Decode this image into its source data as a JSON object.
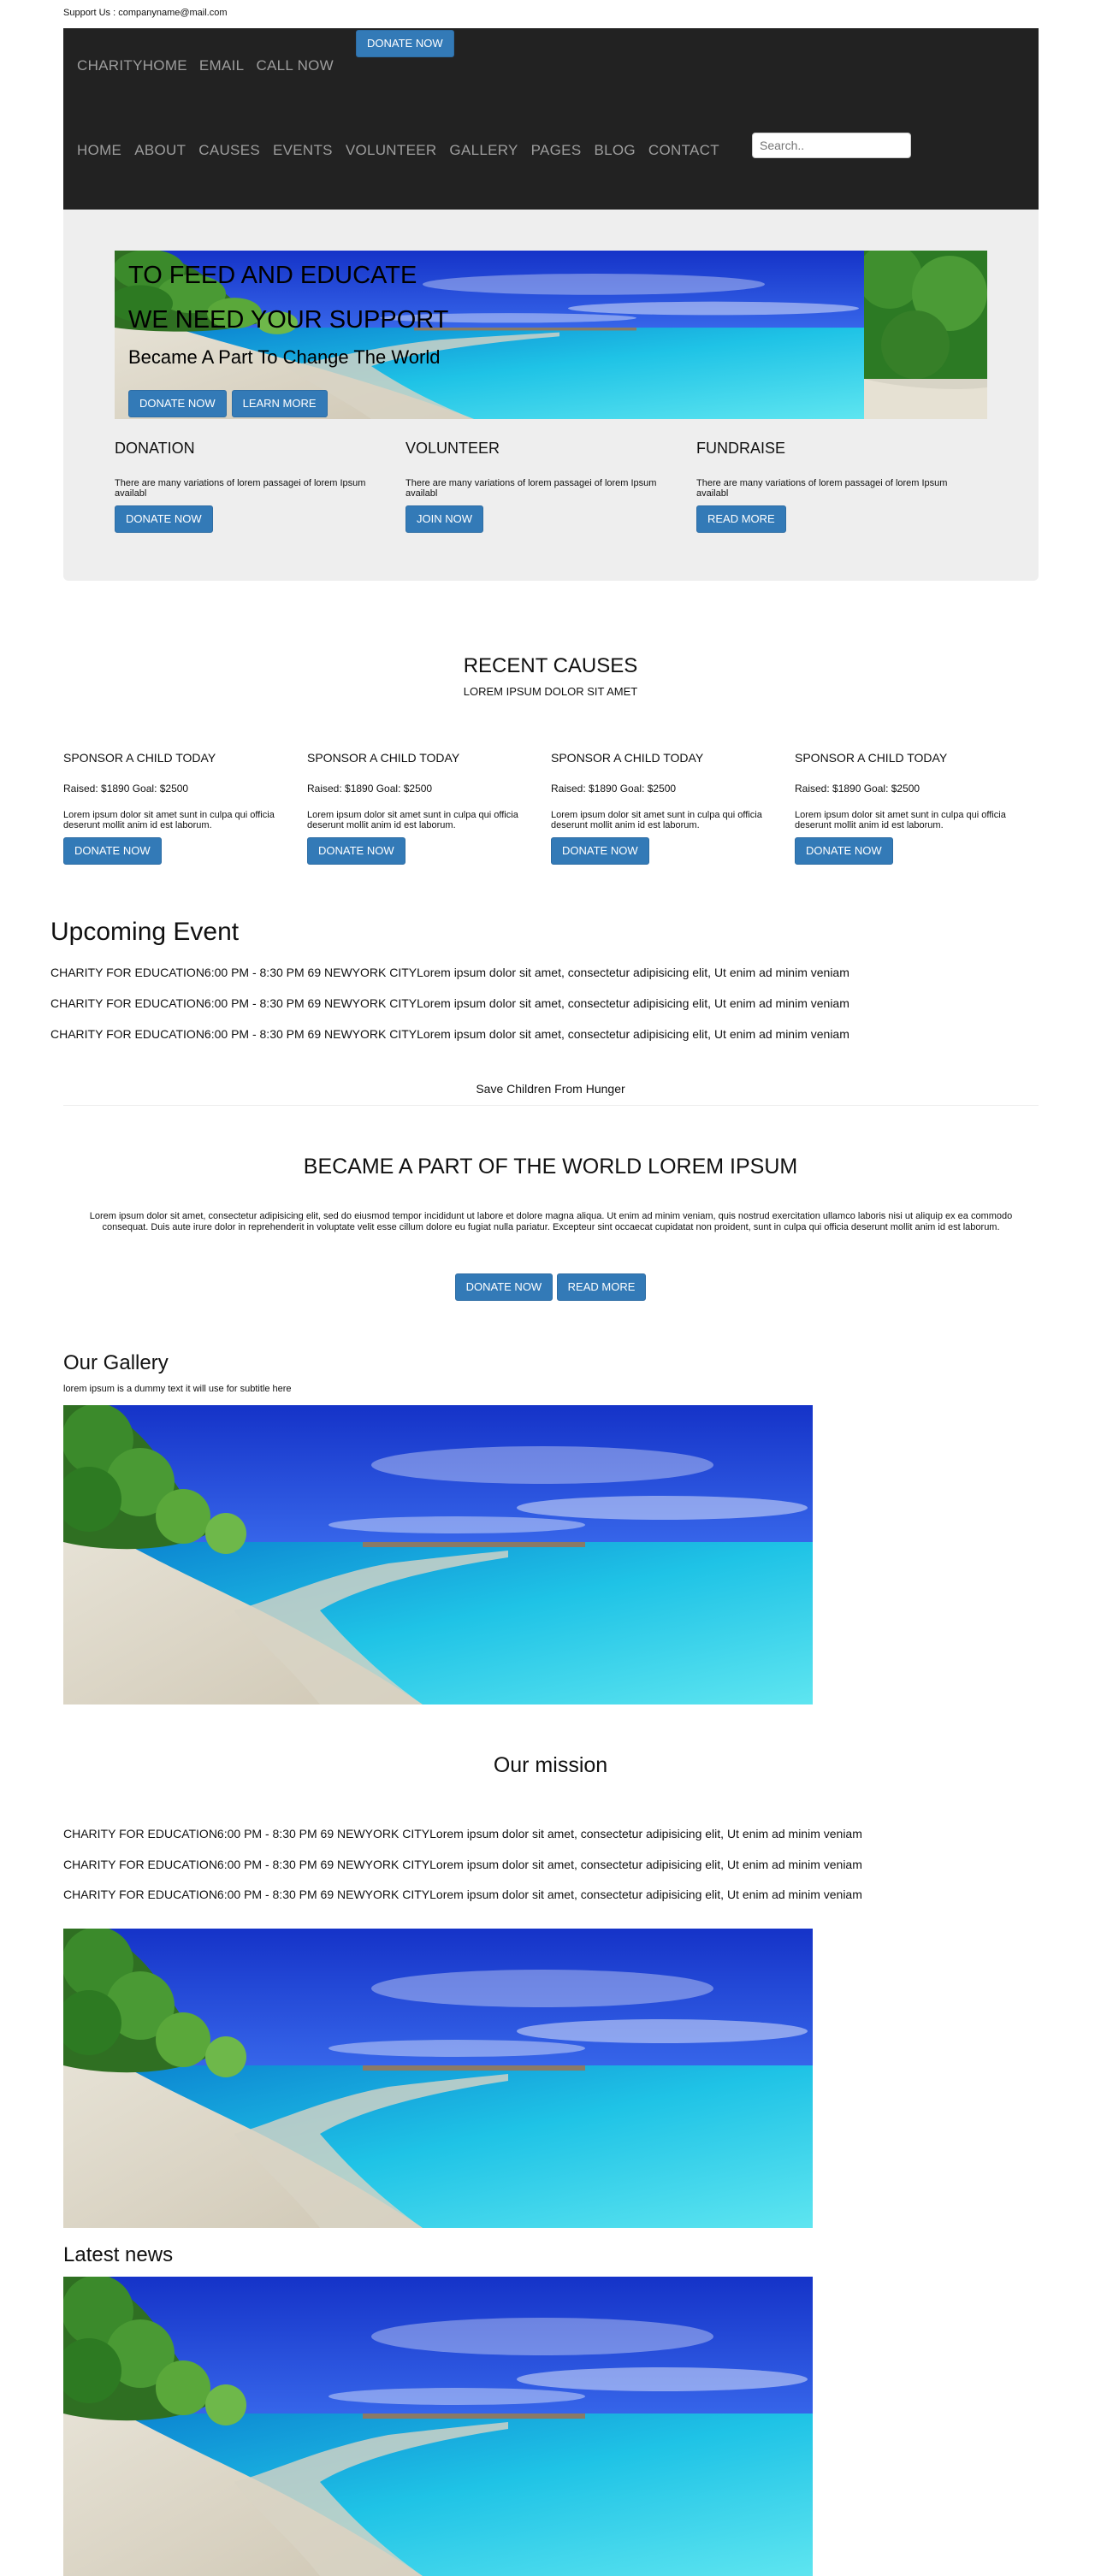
{
  "support": "Support Us : companyname@mail.com",
  "nav": {
    "top_links": [
      "CHARITYHOME",
      "EMAIL",
      "CALL NOW"
    ],
    "donate_label": "DONATE NOW",
    "main_links": [
      "HOME",
      "ABOUT",
      "CAUSES",
      "EVENTS",
      "VOLUNTEER",
      "GALLERY",
      "PAGES",
      "BLOG",
      "CONTACT"
    ],
    "search_placeholder": "Search.."
  },
  "hero": {
    "title1": "TO FEED AND EDUCATE",
    "title2": "WE NEED YOUR SUPPORT",
    "subtitle": "Became A Part To Change The World",
    "donate_label": "DONATE NOW",
    "learn_label": "LEARN MORE"
  },
  "features": [
    {
      "title": "DONATION",
      "text": "There are many variations of lorem passagei of lorem Ipsum availabl",
      "button": "DONATE NOW"
    },
    {
      "title": "VOLUNTEER",
      "text": "There are many variations of lorem passagei of lorem Ipsum availabl",
      "button": "JOIN NOW"
    },
    {
      "title": "FUNDRAISE",
      "text": "There are many variations of lorem passagei of lorem Ipsum availabl",
      "button": "READ MORE"
    }
  ],
  "causes": {
    "title": "RECENT CAUSES",
    "subtitle": "LOREM IPSUM DOLOR SIT AMET",
    "items": [
      {
        "title": "SPONSOR A CHILD TODAY",
        "raised": "Raised: $1890 Goal: $2500",
        "text": "Lorem ipsum dolor sit amet sunt in culpa qui officia deserunt mollit anim id est laborum.",
        "button": "DONATE NOW"
      },
      {
        "title": "SPONSOR A CHILD TODAY",
        "raised": "Raised: $1890 Goal: $2500",
        "text": "Lorem ipsum dolor sit amet sunt in culpa qui officia deserunt mollit anim id est laborum.",
        "button": "DONATE NOW"
      },
      {
        "title": "SPONSOR A CHILD TODAY",
        "raised": "Raised: $1890 Goal: $2500",
        "text": "Lorem ipsum dolor sit amet sunt in culpa qui officia deserunt mollit anim id est laborum.",
        "button": "DONATE NOW"
      },
      {
        "title": "SPONSOR A CHILD TODAY",
        "raised": "Raised: $1890 Goal: $2500",
        "text": "Lorem ipsum dolor sit amet sunt in culpa qui officia deserunt mollit anim id est laborum.",
        "button": "DONATE NOW"
      }
    ]
  },
  "upcoming": {
    "title": "Upcoming Event",
    "events": [
      "CHARITY FOR EDUCATION6:00 PM - 8:30 PM 69 NEWYORK CITYLorem ipsum dolor sit amet, consectetur adipisicing elit, Ut enim ad minim veniam",
      "CHARITY FOR EDUCATION6:00 PM - 8:30 PM 69 NEWYORK CITYLorem ipsum dolor sit amet, consectetur adipisicing elit, Ut enim ad minim veniam",
      "CHARITY FOR EDUCATION6:00 PM - 8:30 PM 69 NEWYORK CITYLorem ipsum dolor sit amet, consectetur adipisicing elit, Ut enim ad minim veniam"
    ]
  },
  "save_text": "Save Children From Hunger",
  "became": {
    "title": "BECAME A PART OF THE WORLD LOREM IPSUM",
    "text": "Lorem ipsum dolor sit amet, consectetur adipisicing elit, sed do eiusmod tempor incididunt ut labore et dolore magna aliqua. Ut enim ad minim veniam, quis nostrud exercitation ullamco laboris nisi ut aliquip ex ea commodo consequat. Duis aute irure dolor in reprehenderit in voluptate velit esse cillum dolore eu fugiat nulla pariatur. Excepteur sint occaecat cupidatat non proident, sunt in culpa qui officia deserunt mollit anim id est laborum.",
    "donate_label": "DONATE NOW",
    "read_label": "READ MORE"
  },
  "gallery": {
    "title": "Our Gallery",
    "subtitle": "lorem ipsum is a dummy text it will use for subtitle here"
  },
  "mission": {
    "title": "Our mission",
    "lines": [
      "CHARITY FOR EDUCATION6:00 PM - 8:30 PM 69 NEWYORK CITYLorem ipsum dolor sit amet, consectetur adipisicing elit, Ut enim ad minim veniam",
      "CHARITY FOR EDUCATION6:00 PM - 8:30 PM 69 NEWYORK CITYLorem ipsum dolor sit amet, consectetur adipisicing elit, Ut enim ad minim veniam",
      "CHARITY FOR EDUCATION6:00 PM - 8:30 PM 69 NEWYORK CITYLorem ipsum dolor sit amet, consectetur adipisicing elit, Ut enim ad minim veniam"
    ]
  },
  "news": {
    "title": "Latest news"
  },
  "colors": {
    "navbar": "#222222",
    "nav_text": "#9d9d9d",
    "button": "#337ab7",
    "jumbotron": "#eeeeee"
  }
}
